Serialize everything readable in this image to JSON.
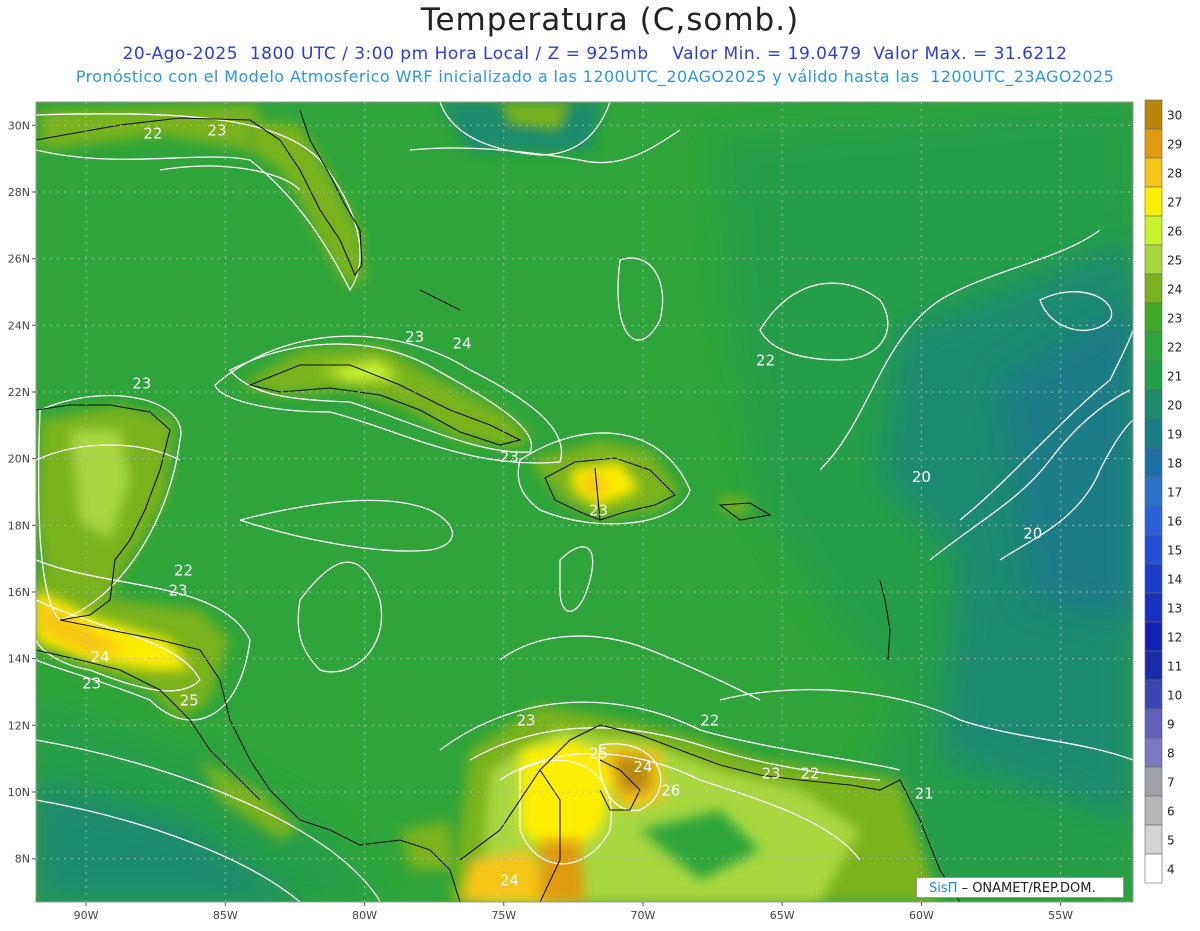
{
  "header": {
    "title": "Temperatura (C,somb.)",
    "subtitle_line1": "20-Ago-2025  1800 UTC / 3:00 pm Hora Local / Z = 925mb    Valor Min. = 19.0479  Valor Max. = 31.6212",
    "subtitle_line2": "Pronóstico con el Modelo Atmosferico WRF inicializado a las 1200UTC_20AGO2025 y válido hasta las  1200UTC_23AGO2025"
  },
  "credit": {
    "brand": "SisΠ",
    "rest": "– ONAMET/REP.DOM."
  },
  "axes": {
    "lat_labels": [
      "30N",
      "28N",
      "26N",
      "24N",
      "22N",
      "20N",
      "18N",
      "16N",
      "14N",
      "12N",
      "10N",
      "8N"
    ],
    "lat_values": [
      30,
      28,
      26,
      24,
      22,
      20,
      18,
      16,
      14,
      12,
      10,
      8
    ],
    "lon_labels": [
      "90W",
      "85W",
      "80W",
      "75W",
      "70W",
      "65W",
      "60W",
      "55W"
    ],
    "lon_values": [
      -90,
      -85,
      -80,
      -75,
      -70,
      -65,
      -60,
      -55
    ],
    "lat_range": [
      6.7,
      30.7
    ],
    "lon_range": [
      -91.8,
      -52.4
    ],
    "grid": "dotted"
  },
  "colorbar": {
    "labels": [
      "30",
      "29",
      "28",
      "27",
      "26",
      "25",
      "24",
      "23",
      "22",
      "21",
      "20",
      "19",
      "18",
      "17",
      "16",
      "15",
      "14",
      "13",
      "12",
      "11",
      "10",
      "9",
      "8",
      "7",
      "6",
      "5",
      "4"
    ],
    "colors": [
      "#b8860b",
      "#e09a10",
      "#f5c518",
      "#ffee00",
      "#c8f230",
      "#a8d840",
      "#79b21e",
      "#3fa82a",
      "#2ea43a",
      "#259e48",
      "#1e8a6e",
      "#1a7d86",
      "#1f6fa5",
      "#2a72c8",
      "#2b62d8",
      "#2250d4",
      "#1c3ccc",
      "#1830c0",
      "#1420b0",
      "#1a2aa8",
      "#3a48b0",
      "#6060b8",
      "#7e78c0",
      "#a0a0a8",
      "#b8b8b8",
      "#d4d4d4",
      "#ffffff"
    ]
  },
  "contour_labels": [
    {
      "text": "22",
      "lon": -87.6,
      "lat": 29.6
    },
    {
      "text": "23",
      "lon": -85.3,
      "lat": 29.7
    },
    {
      "text": "23",
      "lon": -78.2,
      "lat": 23.5
    },
    {
      "text": "24",
      "lon": -76.5,
      "lat": 23.3
    },
    {
      "text": "22",
      "lon": -65.6,
      "lat": 22.8
    },
    {
      "text": "23",
      "lon": -88.0,
      "lat": 22.1
    },
    {
      "text": "23",
      "lon": -74.8,
      "lat": 19.9
    },
    {
      "text": "23",
      "lon": -71.6,
      "lat": 18.3
    },
    {
      "text": "20",
      "lon": -60.0,
      "lat": 19.3
    },
    {
      "text": "20",
      "lon": -56.0,
      "lat": 17.6
    },
    {
      "text": "22",
      "lon": -86.5,
      "lat": 16.5
    },
    {
      "text": "23",
      "lon": -86.7,
      "lat": 15.9
    },
    {
      "text": "24",
      "lon": -89.5,
      "lat": 13.9
    },
    {
      "text": "23",
      "lon": -89.8,
      "lat": 13.1
    },
    {
      "text": "25",
      "lon": -86.3,
      "lat": 12.6
    },
    {
      "text": "23",
      "lon": -74.2,
      "lat": 12.0
    },
    {
      "text": "22",
      "lon": -67.6,
      "lat": 12.0
    },
    {
      "text": "25",
      "lon": -71.6,
      "lat": 11.0
    },
    {
      "text": "24",
      "lon": -70.0,
      "lat": 10.6
    },
    {
      "text": "23",
      "lon": -65.4,
      "lat": 10.4
    },
    {
      "text": "22",
      "lon": -64.0,
      "lat": 10.4
    },
    {
      "text": "26",
      "lon": -69.0,
      "lat": 9.9
    },
    {
      "text": "21",
      "lon": -59.9,
      "lat": 9.8
    },
    {
      "text": "24",
      "lon": -74.8,
      "lat": 7.2
    }
  ]
}
